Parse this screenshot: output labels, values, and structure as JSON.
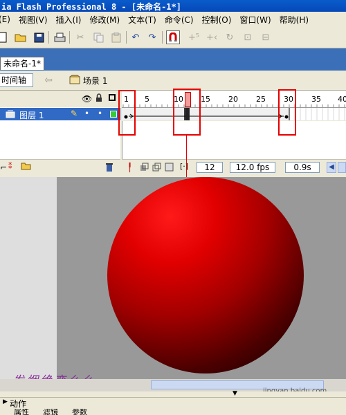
{
  "window": {
    "title": "ia Flash Professional 8 - [未命名-1*]"
  },
  "menu": {
    "items": [
      "(E)",
      "视图(V)",
      "插入(I)",
      "修改(M)",
      "文本(T)",
      "命令(C)",
      "控制(O)",
      "窗口(W)",
      "帮助(H)"
    ]
  },
  "document": {
    "tab_label": "未命名-1*"
  },
  "timeline": {
    "timeline_button": "时间轴",
    "scene_label": "场景 1",
    "layer_name": "图层 1",
    "ruler_ticks": [
      "1",
      "5",
      "10",
      "15",
      "20",
      "25",
      "30",
      "35",
      "40"
    ],
    "current_frame": "12",
    "frame_rate": "12.0 fps",
    "elapsed_time": "0.9s"
  },
  "panels": {
    "actions_label": "动作",
    "tabs": [
      "属性",
      "滤镜",
      "参数"
    ]
  },
  "watermark": {
    "text": "发烟绝恋么么",
    "site": "jingyan.baidu.com"
  },
  "colors": {
    "accent": "#316ac5",
    "highlight": "#e60000",
    "ball": "#e20000",
    "stage": "#999999"
  },
  "icons": [
    "new-icon",
    "open-icon",
    "save-icon",
    "print-icon",
    "cut-icon",
    "copy-icon",
    "paste-icon",
    "undo-icon",
    "redo-icon",
    "snap-magnet-icon",
    "smooth-icon",
    "straighten-icon",
    "rotate-icon",
    "scale-icon",
    "align-icon"
  ]
}
